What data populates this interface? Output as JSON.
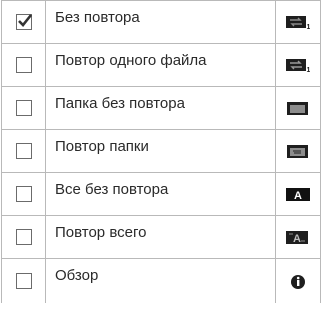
{
  "options": [
    {
      "label": "Без повтора",
      "checked": true,
      "icon": "repeat-off-icon"
    },
    {
      "label": "Повтор одного файла",
      "checked": false,
      "icon": "repeat-one-icon"
    },
    {
      "label": "Папка без повтора",
      "checked": false,
      "icon": "folder-icon"
    },
    {
      "label": "Повтор папки",
      "checked": false,
      "icon": "folder-repeat-icon"
    },
    {
      "label": "Все без повтора",
      "checked": false,
      "icon": "all-icon",
      "icon_text": "A"
    },
    {
      "label": "Повтор всего",
      "checked": false,
      "icon": "repeat-all-icon",
      "icon_text": "A"
    },
    {
      "label": "Обзор",
      "checked": false,
      "icon": "info-icon"
    }
  ],
  "colors": {
    "border": "#b9b9b9",
    "checkbox_border": "#6b6b6b",
    "icon_dark": "#1a1a1a"
  }
}
